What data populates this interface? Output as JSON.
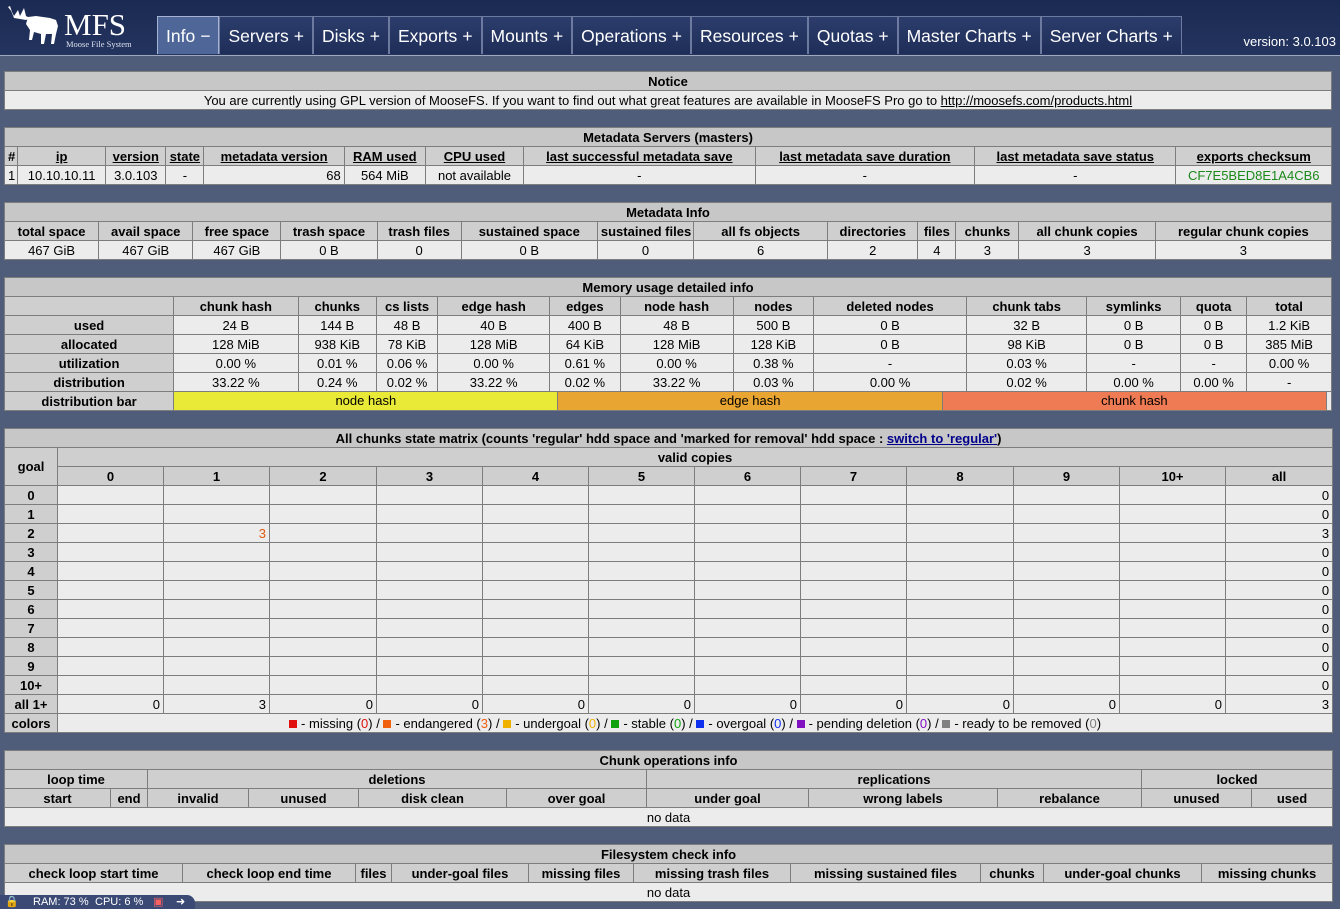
{
  "header": {
    "brand": "MFS",
    "brand_sub": "Moose File System",
    "version": "version: 3.0.103",
    "tabs": [
      {
        "label": "Info",
        "sign": "−",
        "active": true
      },
      {
        "label": "Servers",
        "sign": "+"
      },
      {
        "label": "Disks",
        "sign": "+"
      },
      {
        "label": "Exports",
        "sign": "+"
      },
      {
        "label": "Mounts",
        "sign": "+"
      },
      {
        "label": "Operations",
        "sign": "+"
      },
      {
        "label": "Resources",
        "sign": "+"
      },
      {
        "label": "Quotas",
        "sign": "+"
      },
      {
        "label": "Master Charts",
        "sign": "+"
      },
      {
        "label": "Server Charts",
        "sign": "+"
      }
    ]
  },
  "notice": {
    "title": "Notice",
    "text": "You are currently using GPL version of MooseFS. If you want to find out what great features are available in MooseFS Pro go to ",
    "link": "http://moosefs.com/products.html"
  },
  "masters": {
    "title": "Metadata Servers (masters)",
    "columns": [
      "#",
      "ip",
      "version",
      "state",
      "metadata version",
      "RAM used",
      "CPU used",
      "last successful metadata save",
      "last metadata save duration",
      "last metadata save status",
      "exports checksum"
    ],
    "row": [
      "1",
      "10.10.10.11",
      "3.0.103",
      "-",
      "68",
      "564 MiB",
      "not available",
      "-",
      "-",
      "-",
      "CF7E5BED8E1A4CB6"
    ]
  },
  "metainfo": {
    "title": "Metadata Info",
    "columns": [
      "total space",
      "avail space",
      "free space",
      "trash space",
      "trash files",
      "sustained space",
      "sustained files",
      "all fs objects",
      "directories",
      "files",
      "chunks",
      "all chunk copies",
      "regular chunk copies"
    ],
    "row": [
      "467 GiB",
      "467 GiB",
      "467 GiB",
      "0 B",
      "0",
      "0 B",
      "0",
      "6",
      "2",
      "4",
      "3",
      "3",
      "3"
    ]
  },
  "memory": {
    "title": "Memory usage detailed info",
    "columns": [
      "chunk hash",
      "chunks",
      "cs lists",
      "edge hash",
      "edges",
      "node hash",
      "nodes",
      "deleted nodes",
      "chunk tabs",
      "symlinks",
      "quota",
      "total"
    ],
    "rows": [
      {
        "label": "used",
        "values": [
          "24 B",
          "144 B",
          "48 B",
          "40 B",
          "400 B",
          "48 B",
          "500 B",
          "0 B",
          "32 B",
          "0 B",
          "0 B",
          "1.2 KiB"
        ]
      },
      {
        "label": "allocated",
        "values": [
          "128 MiB",
          "938 KiB",
          "78 KiB",
          "128 MiB",
          "64 KiB",
          "128 MiB",
          "128 KiB",
          "0 B",
          "98 KiB",
          "0 B",
          "0 B",
          "385 MiB"
        ]
      },
      {
        "label": "utilization",
        "values": [
          "0.00 %",
          "0.01 %",
          "0.06 %",
          "0.00 %",
          "0.61 %",
          "0.00 %",
          "0.38 %",
          "-",
          "0.03 %",
          "-",
          "-",
          "0.00 %"
        ]
      },
      {
        "label": "distribution",
        "values": [
          "33.22 %",
          "0.24 %",
          "0.02 %",
          "33.22 %",
          "0.02 %",
          "33.22 %",
          "0.03 %",
          "0.00 %",
          "0.02 %",
          "0.00 %",
          "0.00 %",
          "-"
        ]
      }
    ],
    "bar_label": "distribution bar",
    "bar": [
      {
        "label": "node hash",
        "share": 0.3322,
        "color": "#e9e938"
      },
      {
        "label": "edge hash",
        "share": 0.3322,
        "color": "#e8a532"
      },
      {
        "label": "chunk hash",
        "share": 0.3322,
        "color": "#ee7b53"
      }
    ]
  },
  "matrix": {
    "title_prefix": "All chunks state matrix (counts 'regular' hdd space and 'marked for removal' hdd space : ",
    "switch_link": "switch to 'regular'",
    "title_suffix": ")",
    "goal_label": "goal",
    "valid_label": "valid copies",
    "columns": [
      "0",
      "1",
      "2",
      "3",
      "4",
      "5",
      "6",
      "7",
      "8",
      "9",
      "10+",
      "all"
    ],
    "rows": [
      {
        "goal": "0",
        "cells": [
          "",
          "",
          "",
          "",
          "",
          "",
          "",
          "",
          "",
          "",
          "",
          "0"
        ]
      },
      {
        "goal": "1",
        "cells": [
          "",
          "",
          "",
          "",
          "",
          "",
          "",
          "",
          "",
          "",
          "",
          "0"
        ]
      },
      {
        "goal": "2",
        "cells": [
          "",
          "3",
          "",
          "",
          "",
          "",
          "",
          "",
          "",
          "",
          "",
          "3"
        ]
      },
      {
        "goal": "3",
        "cells": [
          "",
          "",
          "",
          "",
          "",
          "",
          "",
          "",
          "",
          "",
          "",
          "0"
        ]
      },
      {
        "goal": "4",
        "cells": [
          "",
          "",
          "",
          "",
          "",
          "",
          "",
          "",
          "",
          "",
          "",
          "0"
        ]
      },
      {
        "goal": "5",
        "cells": [
          "",
          "",
          "",
          "",
          "",
          "",
          "",
          "",
          "",
          "",
          "",
          "0"
        ]
      },
      {
        "goal": "6",
        "cells": [
          "",
          "",
          "",
          "",
          "",
          "",
          "",
          "",
          "",
          "",
          "",
          "0"
        ]
      },
      {
        "goal": "7",
        "cells": [
          "",
          "",
          "",
          "",
          "",
          "",
          "",
          "",
          "",
          "",
          "",
          "0"
        ]
      },
      {
        "goal": "8",
        "cells": [
          "",
          "",
          "",
          "",
          "",
          "",
          "",
          "",
          "",
          "",
          "",
          "0"
        ]
      },
      {
        "goal": "9",
        "cells": [
          "",
          "",
          "",
          "",
          "",
          "",
          "",
          "",
          "",
          "",
          "",
          "0"
        ]
      },
      {
        "goal": "10+",
        "cells": [
          "",
          "",
          "",
          "",
          "",
          "",
          "",
          "",
          "",
          "",
          "",
          "0"
        ]
      },
      {
        "goal": "all 1+",
        "cells": [
          "0",
          "3",
          "0",
          "0",
          "0",
          "0",
          "0",
          "0",
          "0",
          "0",
          "0",
          "3"
        ]
      }
    ],
    "colors_label": "colors",
    "legend": [
      {
        "color": "#e01010",
        "label": "missing",
        "count": "0"
      },
      {
        "color": "#f06010",
        "label": "endangered",
        "count": "3"
      },
      {
        "color": "#f0b000",
        "label": "undergoal",
        "count": "0"
      },
      {
        "color": "#10a010",
        "label": "stable",
        "count": "0"
      },
      {
        "color": "#1030f0",
        "label": "overgoal",
        "count": "0"
      },
      {
        "color": "#8010c0",
        "label": "pending deletion",
        "count": "0"
      },
      {
        "color": "#808080",
        "label": "ready to be removed",
        "count": "0"
      }
    ]
  },
  "chunkops": {
    "title": "Chunk operations info",
    "group_headers": [
      "loop time",
      "deletions",
      "replications",
      "locked"
    ],
    "columns": [
      "start",
      "end",
      "invalid",
      "unused",
      "disk clean",
      "over goal",
      "under goal",
      "wrong labels",
      "rebalance",
      "unused",
      "used"
    ],
    "empty": "no data"
  },
  "fscheck": {
    "title": "Filesystem check info",
    "columns": [
      "check loop start time",
      "check loop end time",
      "files",
      "under-goal files",
      "missing files",
      "missing trash files",
      "missing sustained files",
      "chunks",
      "under-goal chunks",
      "missing chunks"
    ],
    "empty": "no data"
  },
  "statusbar": {
    "ram": "RAM: 73 %",
    "cpu": "CPU: 6 %"
  }
}
